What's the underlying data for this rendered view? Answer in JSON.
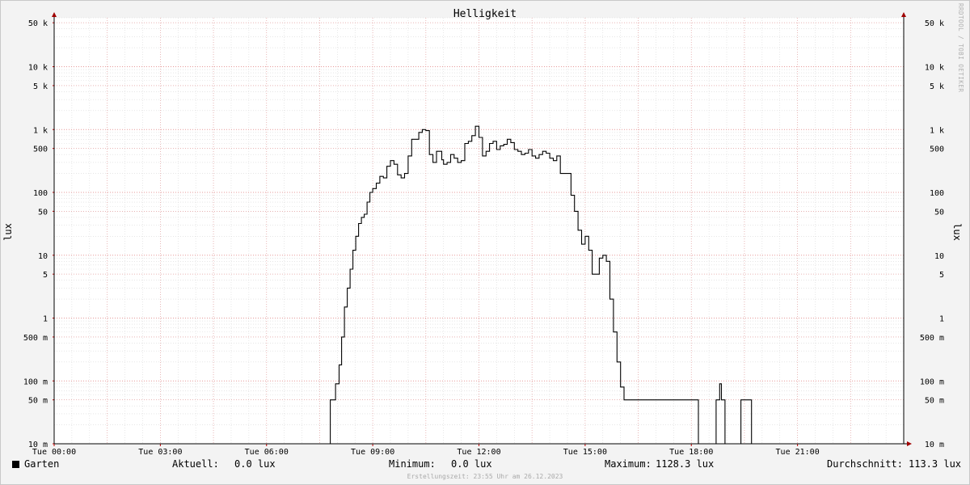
{
  "watermark": "RRDTOOL / TOBI OETIKER",
  "chart_data": {
    "type": "line",
    "title": "Helligkeit",
    "ylabel": "lux",
    "yscale": "log",
    "ylim": [
      0.01,
      60000
    ],
    "xlim": [
      0,
      24
    ],
    "grid": true,
    "y_major_ticks": [
      {
        "value": 0.01,
        "label": "10 m"
      },
      {
        "value": 0.05,
        "label": "50 m"
      },
      {
        "value": 0.1,
        "label": "100 m"
      },
      {
        "value": 0.5,
        "label": "500 m"
      },
      {
        "value": 1,
        "label": "1"
      },
      {
        "value": 5,
        "label": "5"
      },
      {
        "value": 10,
        "label": "10"
      },
      {
        "value": 50,
        "label": "50"
      },
      {
        "value": 100,
        "label": "100"
      },
      {
        "value": 500,
        "label": "500"
      },
      {
        "value": 1000,
        "label": "1 k"
      },
      {
        "value": 5000,
        "label": "5 k"
      },
      {
        "value": 10000,
        "label": "10 k"
      },
      {
        "value": 50000,
        "label": "50 k"
      }
    ],
    "x_ticks": [
      {
        "value": 0,
        "label": "Tue 00:00"
      },
      {
        "value": 3,
        "label": "Tue 03:00"
      },
      {
        "value": 6,
        "label": "Tue 06:00"
      },
      {
        "value": 9,
        "label": "Tue 09:00"
      },
      {
        "value": 12,
        "label": "Tue 12:00"
      },
      {
        "value": 15,
        "label": "Tue 15:00"
      },
      {
        "value": 18,
        "label": "Tue 18:00"
      },
      {
        "value": 21,
        "label": "Tue 21:00"
      }
    ],
    "series": [
      {
        "name": "Garten",
        "color": "#000000",
        "x": [
          0,
          7.8,
          7.95,
          8.05,
          8.12,
          8.2,
          8.28,
          8.36,
          8.44,
          8.52,
          8.6,
          8.68,
          8.76,
          8.84,
          8.92,
          9.0,
          9.1,
          9.2,
          9.3,
          9.4,
          9.5,
          9.6,
          9.7,
          9.8,
          9.9,
          10.0,
          10.1,
          10.3,
          10.4,
          10.5,
          10.6,
          10.7,
          10.8,
          10.95,
          11.0,
          11.1,
          11.2,
          11.3,
          11.4,
          11.5,
          11.6,
          11.7,
          11.8,
          11.9,
          12.0,
          12.1,
          12.2,
          12.3,
          12.4,
          12.5,
          12.6,
          12.7,
          12.8,
          12.9,
          13.0,
          13.1,
          13.2,
          13.3,
          13.4,
          13.5,
          13.6,
          13.7,
          13.8,
          13.9,
          14.0,
          14.1,
          14.2,
          14.3,
          14.4,
          14.5,
          14.6,
          14.7,
          14.8,
          14.9,
          15.0,
          15.1,
          15.2,
          15.3,
          15.4,
          15.5,
          15.6,
          15.7,
          15.8,
          15.9,
          16.0,
          16.1,
          16.2,
          16.3,
          16.4,
          16.5,
          16.6,
          16.7,
          16.8,
          16.9,
          17.0,
          17.1,
          17.2,
          17.3,
          18.2,
          18.3,
          18.6,
          18.7,
          18.8,
          18.85,
          18.9,
          18.95,
          19.3,
          19.4,
          19.6,
          19.7,
          24
        ],
        "y": [
          0.01,
          0.05,
          0.09,
          0.18,
          0.5,
          1.5,
          3,
          6,
          12,
          20,
          32,
          40,
          45,
          70,
          100,
          115,
          140,
          180,
          170,
          260,
          320,
          280,
          190,
          170,
          200,
          380,
          700,
          900,
          1000,
          960,
          400,
          300,
          450,
          330,
          280,
          300,
          400,
          350,
          300,
          320,
          600,
          650,
          800,
          1128.3,
          750,
          380,
          450,
          600,
          650,
          480,
          550,
          580,
          700,
          620,
          480,
          450,
          400,
          420,
          480,
          380,
          350,
          400,
          450,
          420,
          350,
          320,
          380,
          200,
          200,
          200,
          90,
          50,
          25,
          15,
          20,
          12,
          5,
          5,
          9,
          10,
          8,
          2,
          0.6,
          0.2,
          0.08,
          0.05,
          0.05,
          0.05,
          0.05,
          0.05,
          0.05,
          0.05,
          0.05,
          0.05,
          0.05,
          0.05,
          0.05,
          0.05,
          0.01,
          0.01,
          0.01,
          0.05,
          0.09,
          0.05,
          0.05,
          0.01,
          0.01,
          0.05,
          0.05,
          0.01,
          0.01
        ]
      }
    ]
  },
  "legend": {
    "name": "Garten",
    "current_label": "Aktuell:",
    "current_value": "0.0 lux",
    "min_label": "Minimum:",
    "min_value": "0.0 lux",
    "max_label": "Maximum:",
    "max_value": "1128.3 lux",
    "avg_label": "Durchschnitt:",
    "avg_value": "113.3 lux"
  },
  "footer": "Erstellungszeit: 23:55 Uhr am 26.12.2023"
}
